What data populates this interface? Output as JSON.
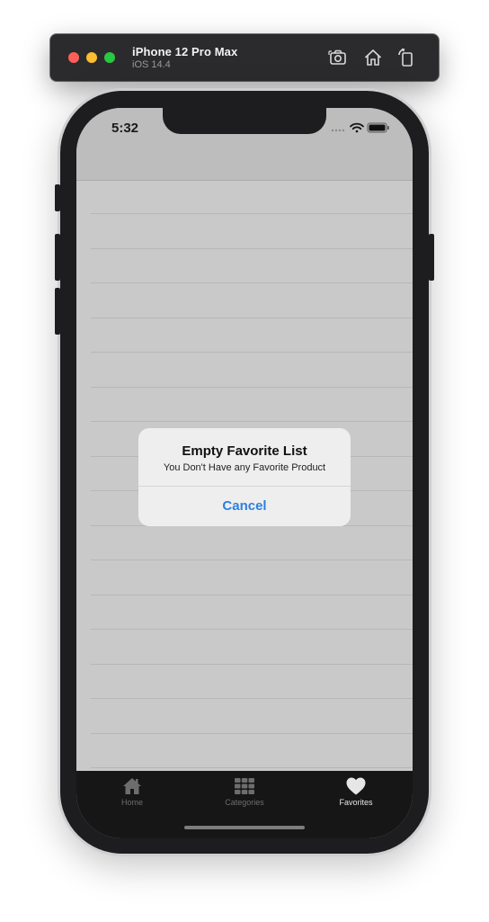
{
  "simulator": {
    "device_name": "iPhone 12 Pro Max",
    "os_version": "iOS 14.4",
    "toolbar_icons": [
      "screenshot-icon",
      "home-icon",
      "rotate-icon"
    ]
  },
  "status_bar": {
    "time": "5:32",
    "icons": [
      "signal-dots-icon",
      "wifi-icon",
      "battery-icon"
    ]
  },
  "alert": {
    "title": "Empty Favorite List",
    "message": "You Don't Have any Favorite Product",
    "cancel_label": "Cancel",
    "cancel_color": "#2c7fe0"
  },
  "tab_bar": {
    "tabs": [
      {
        "label": "Home",
        "icon": "house-icon",
        "active": false
      },
      {
        "label": "Categories",
        "icon": "grid-icon",
        "active": false
      },
      {
        "label": "Favorites",
        "icon": "heart-icon",
        "active": true
      }
    ]
  },
  "colors": {
    "dimmed_background": "#c9c9c9",
    "tab_bar_background": "#161616",
    "active_tab": "#e6e6e6",
    "inactive_tab": "#6d6d6d"
  }
}
